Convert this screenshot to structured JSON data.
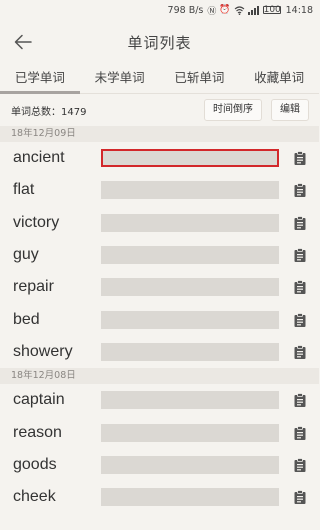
{
  "status_bar": {
    "speed": "798 B/s",
    "battery": "100",
    "time": "14:18"
  },
  "header": {
    "title": "单词列表"
  },
  "tabs": [
    {
      "label": "已学单词",
      "active": true
    },
    {
      "label": "未学单词",
      "active": false
    },
    {
      "label": "已斩单词",
      "active": false
    },
    {
      "label": "收藏单词",
      "active": false
    }
  ],
  "toolbar": {
    "word_count": "单词总数：1479",
    "sort_label": "时间倒序",
    "edit_label": "编辑"
  },
  "groups": [
    {
      "date": "18年12月09日",
      "words": [
        "ancient",
        "flat",
        "victory",
        "guy",
        "repair",
        "bed",
        "showery"
      ]
    },
    {
      "date": "18年12月08日",
      "words": [
        "captain",
        "reason",
        "goods",
        "cheek"
      ]
    }
  ],
  "selected_word": "ancient",
  "colors": {
    "background": "#f5f3ef",
    "meaning_mask": "#dbd8d3",
    "selection_border": "#d2272a",
    "tab_indicator": "#a7a3a0"
  }
}
